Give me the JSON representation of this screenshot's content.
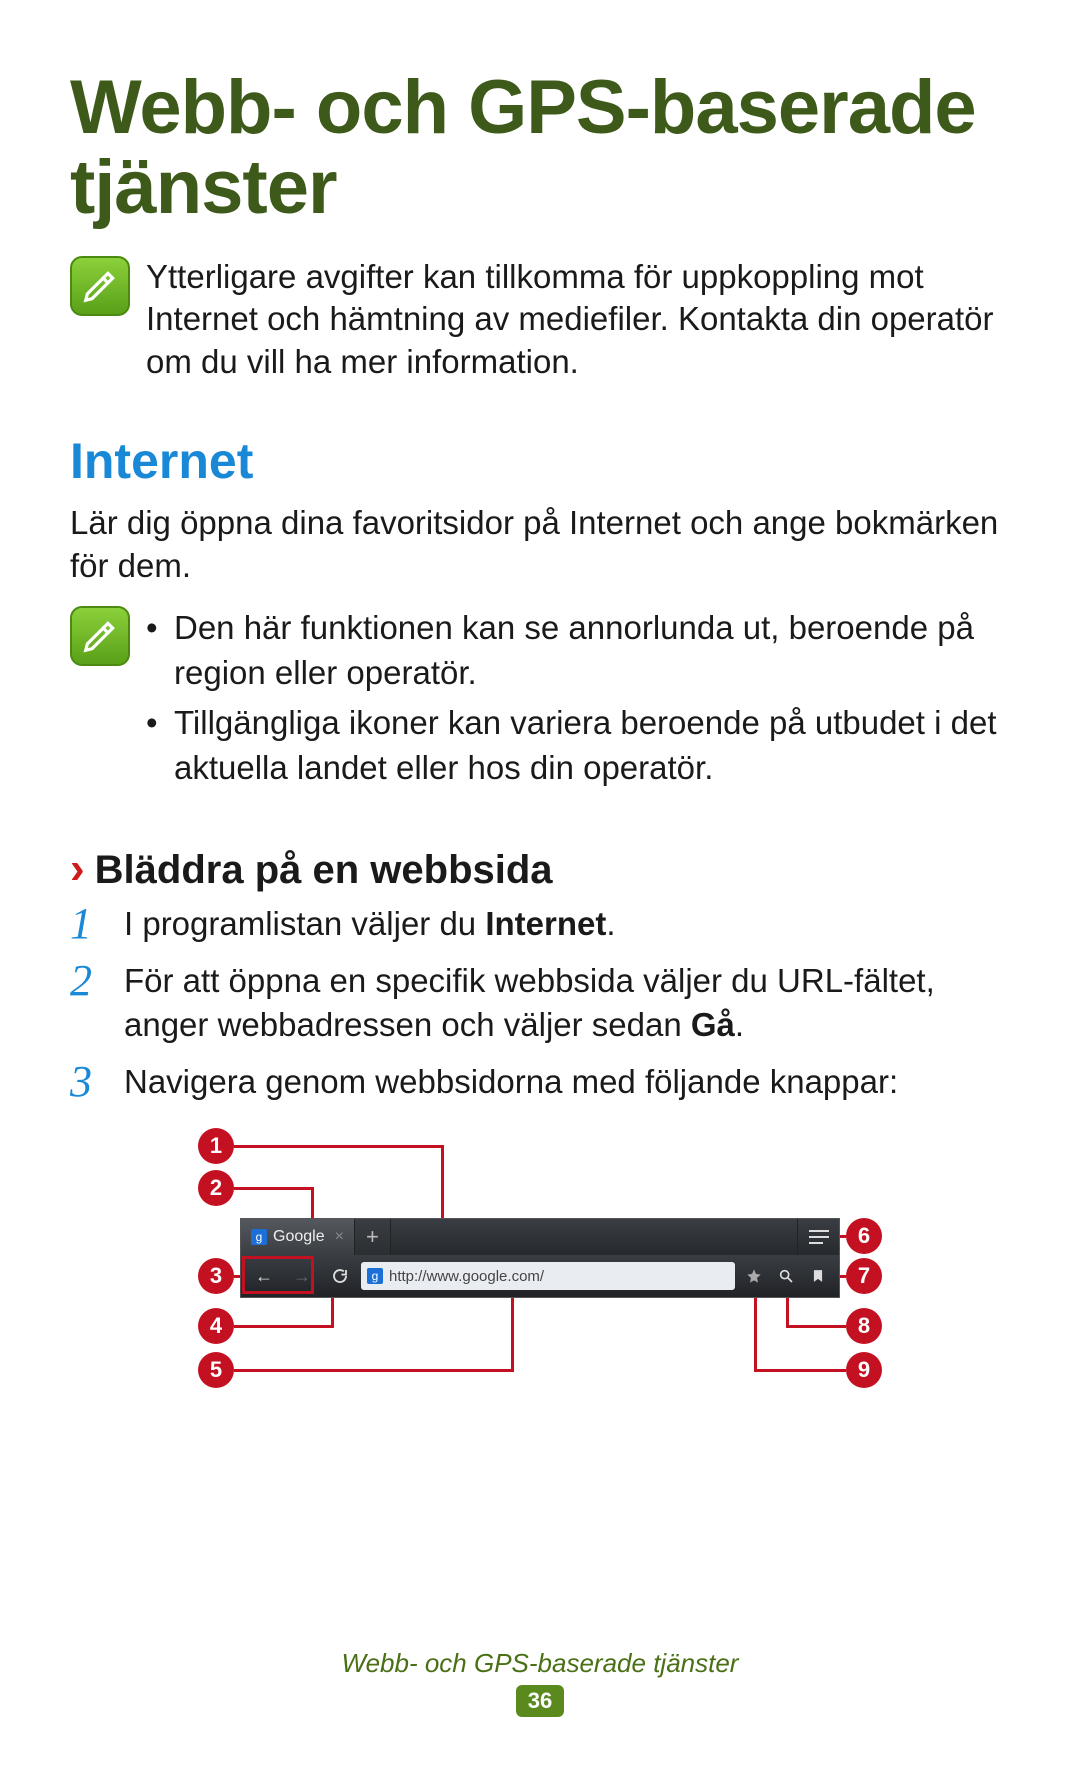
{
  "title": "Webb- och GPS-baserade tjänster",
  "note1": "Ytterligare avgifter kan tillkomma för uppkoppling mot Internet och hämtning av mediefiler. Kontakta din operatör om du vill ha mer information.",
  "section": {
    "heading": "Internet",
    "intro": "Lär dig öppna dina favoritsidor på Internet och ange bokmärken för dem.",
    "notes": [
      "Den här funktionen kan se annorlunda ut, beroende på region eller operatör.",
      "Tillgängliga ikoner kan variera beroende på utbudet i det aktuella landet eller hos din operatör."
    ]
  },
  "sub": {
    "chevron": "›",
    "heading": "Bläddra på en webbsida",
    "steps": [
      {
        "n": "1",
        "pre": "I programlistan väljer du ",
        "bold": "Internet",
        "post": "."
      },
      {
        "n": "2",
        "pre": "För att öppna en specifik webbsida väljer du URL-fältet, anger webbadressen och väljer sedan ",
        "bold": "Gå",
        "post": "."
      },
      {
        "n": "3",
        "pre": "Navigera genom webbsidorna med följande knappar:",
        "bold": "",
        "post": ""
      }
    ]
  },
  "browser": {
    "tab_label": "Google",
    "url": "http://www.google.com/",
    "favicon_letter": "g"
  },
  "callouts": {
    "c1": "1",
    "c2": "2",
    "c3": "3",
    "c4": "4",
    "c5": "5",
    "c6": "6",
    "c7": "7",
    "c8": "8",
    "c9": "9"
  },
  "footer": {
    "text": "Webb- och GPS-baserade tjänster",
    "page": "36"
  }
}
